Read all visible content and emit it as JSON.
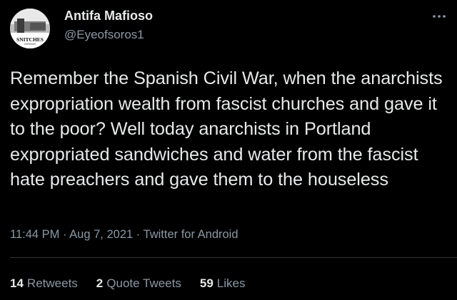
{
  "author": {
    "display_name": "Antifa Mafioso",
    "handle": "@Eyeofsoros1",
    "avatar_caption": "SNITCHES"
  },
  "tweet": {
    "text": "Remember the Spanish Civil War, when the anarchists expropriation wealth from fascist churches and gave it to the poor? Well today anarchists in Portland expropriated sandwiches and water from the fascist hate preachers and gave them to the houseless",
    "time": "11:44 PM",
    "date": "Aug 7, 2021",
    "source": "Twitter for Android",
    "separator": "·"
  },
  "stats": {
    "retweets_count": "14",
    "retweets_label": "Retweets",
    "quotes_count": "2",
    "quotes_label": "Quote Tweets",
    "likes_count": "59",
    "likes_label": "Likes"
  },
  "icons": {
    "more": "more-dots-icon"
  },
  "colors": {
    "background": "#000000",
    "text_primary": "#e7e9ea",
    "text_secondary": "#8b98a5",
    "divider": "#2f3336"
  }
}
